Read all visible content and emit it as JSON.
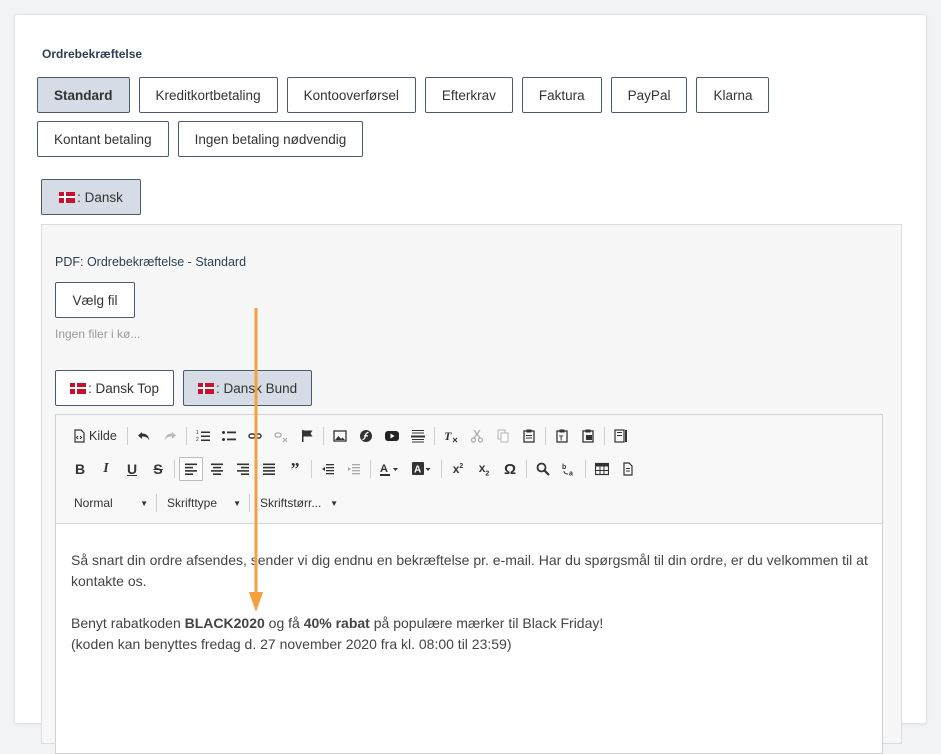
{
  "section_title": "Ordrebekræftelse",
  "payment_tabs_row1": [
    "Standard",
    "Kreditkortbetaling",
    "Kontooverførsel",
    "Efterkrav",
    "Faktura",
    "PayPal",
    "Klarna"
  ],
  "payment_tabs_row2": [
    "Kontant betaling",
    "Ingen betaling nødvendig"
  ],
  "language_button": ": Dansk",
  "pdf_label": "PDF: Ordrebekræftelse - Standard",
  "file_button": "Vælg fil",
  "no_files_text": "Ingen filer i kø...",
  "sub_tabs": [
    ": Dansk Top",
    ": Dansk Bund"
  ],
  "toolbar": {
    "source_label": "Kilde",
    "format_combo": "Normal",
    "font_combo": "Skrifttype",
    "size_combo": "Skriftstørr..."
  },
  "content": {
    "para1": "Så snart din ordre afsendes, sender vi dig endnu en bekræftelse pr. e-mail. Har du spørgsmål til din ordre, er du velkommen til at kontakte os.",
    "para2_prefix": "Benyt rabatkoden ",
    "para2_code": "BLACK2020",
    "para2_mid": " og få ",
    "para2_discount": "40% rabat",
    "para2_suffix": " på populære mærker til Black Friday!",
    "para2_line2": "(koden kan benyttes fredag d. 27 november 2020 fra kl. 08:00 til 23:59)"
  },
  "colors": {
    "arrow": "#f4a03c",
    "active_tab_bg": "#d6dce5",
    "flag_red": "#c8102e"
  }
}
